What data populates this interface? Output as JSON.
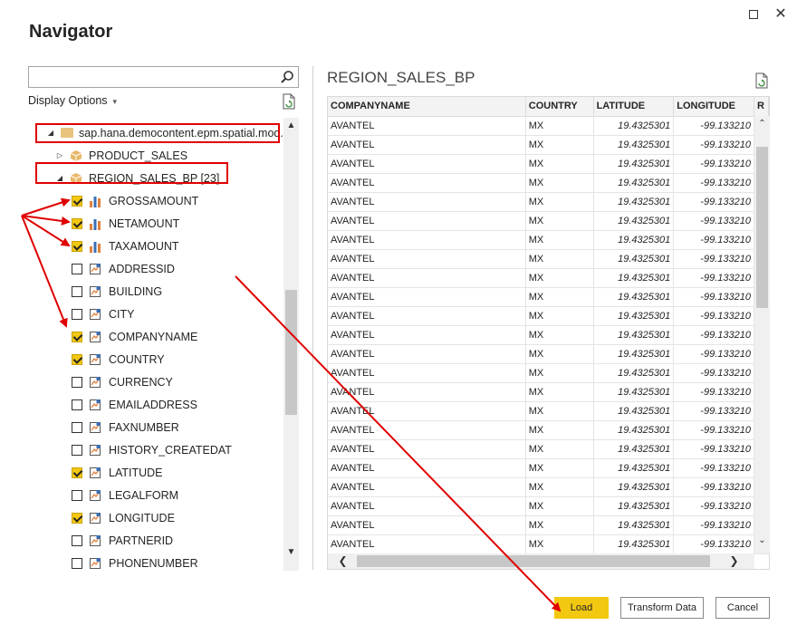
{
  "window": {
    "title": "Navigator",
    "close_glyph": "✕"
  },
  "search": {
    "placeholder": "",
    "value": "",
    "icon": "search-icon"
  },
  "display_options": {
    "label": "Display Options",
    "caret": "▾"
  },
  "tree": {
    "root": {
      "label": "sap.hana.democontent.epm.spatial.mod...",
      "expanded": true
    },
    "tables": [
      {
        "label": "PRODUCT_SALES",
        "expanded": false
      },
      {
        "label": "REGION_SALES_BP [23]",
        "expanded": true
      }
    ],
    "fields": [
      {
        "label": "GROSSAMOUNT",
        "checked": true,
        "kind": "measure"
      },
      {
        "label": "NETAMOUNT",
        "checked": true,
        "kind": "measure"
      },
      {
        "label": "TAXAMOUNT",
        "checked": true,
        "kind": "measure"
      },
      {
        "label": "ADDRESSID",
        "checked": false,
        "kind": "attribute"
      },
      {
        "label": "BUILDING",
        "checked": false,
        "kind": "attribute"
      },
      {
        "label": "CITY",
        "checked": false,
        "kind": "attribute"
      },
      {
        "label": "COMPANYNAME",
        "checked": true,
        "kind": "attribute"
      },
      {
        "label": "COUNTRY",
        "checked": true,
        "kind": "attribute"
      },
      {
        "label": "CURRENCY",
        "checked": false,
        "kind": "attribute"
      },
      {
        "label": "EMAILADDRESS",
        "checked": false,
        "kind": "attribute"
      },
      {
        "label": "FAXNUMBER",
        "checked": false,
        "kind": "attribute"
      },
      {
        "label": "HISTORY_CREATEDAT",
        "checked": false,
        "kind": "attribute"
      },
      {
        "label": "LATITUDE",
        "checked": true,
        "kind": "attribute"
      },
      {
        "label": "LEGALFORM",
        "checked": false,
        "kind": "attribute"
      },
      {
        "label": "LONGITUDE",
        "checked": true,
        "kind": "attribute"
      },
      {
        "label": "PARTNERID",
        "checked": false,
        "kind": "attribute"
      },
      {
        "label": "PHONENUMBER",
        "checked": false,
        "kind": "attribute"
      }
    ]
  },
  "preview": {
    "title": "REGION_SALES_BP",
    "columns": [
      "COMPANYNAME",
      "COUNTRY",
      "LATITUDE",
      "LONGITUDE",
      "R"
    ],
    "rows": [
      [
        "AVANTEL",
        "MX",
        "19.4325301",
        "-99.133210"
      ],
      [
        "AVANTEL",
        "MX",
        "19.4325301",
        "-99.133210"
      ],
      [
        "AVANTEL",
        "MX",
        "19.4325301",
        "-99.133210"
      ],
      [
        "AVANTEL",
        "MX",
        "19.4325301",
        "-99.133210"
      ],
      [
        "AVANTEL",
        "MX",
        "19.4325301",
        "-99.133210"
      ],
      [
        "AVANTEL",
        "MX",
        "19.4325301",
        "-99.133210"
      ],
      [
        "AVANTEL",
        "MX",
        "19.4325301",
        "-99.133210"
      ],
      [
        "AVANTEL",
        "MX",
        "19.4325301",
        "-99.133210"
      ],
      [
        "AVANTEL",
        "MX",
        "19.4325301",
        "-99.133210"
      ],
      [
        "AVANTEL",
        "MX",
        "19.4325301",
        "-99.133210"
      ],
      [
        "AVANTEL",
        "MX",
        "19.4325301",
        "-99.133210"
      ],
      [
        "AVANTEL",
        "MX",
        "19.4325301",
        "-99.133210"
      ],
      [
        "AVANTEL",
        "MX",
        "19.4325301",
        "-99.133210"
      ],
      [
        "AVANTEL",
        "MX",
        "19.4325301",
        "-99.133210"
      ],
      [
        "AVANTEL",
        "MX",
        "19.4325301",
        "-99.133210"
      ],
      [
        "AVANTEL",
        "MX",
        "19.4325301",
        "-99.133210"
      ],
      [
        "AVANTEL",
        "MX",
        "19.4325301",
        "-99.133210"
      ],
      [
        "AVANTEL",
        "MX",
        "19.4325301",
        "-99.133210"
      ],
      [
        "AVANTEL",
        "MX",
        "19.4325301",
        "-99.133210"
      ],
      [
        "AVANTEL",
        "MX",
        "19.4325301",
        "-99.133210"
      ],
      [
        "AVANTEL",
        "MX",
        "19.4325301",
        "-99.133210"
      ],
      [
        "AVANTEL",
        "MX",
        "19.4325301",
        "-99.133210"
      ],
      [
        "AVANTEL",
        "MX",
        "19.4325301",
        "-99.133210"
      ]
    ]
  },
  "buttons": {
    "load": "Load",
    "transform": "Transform Data",
    "cancel": "Cancel"
  },
  "colors": {
    "accent": "#f2c811",
    "annotation": "#e00000"
  }
}
